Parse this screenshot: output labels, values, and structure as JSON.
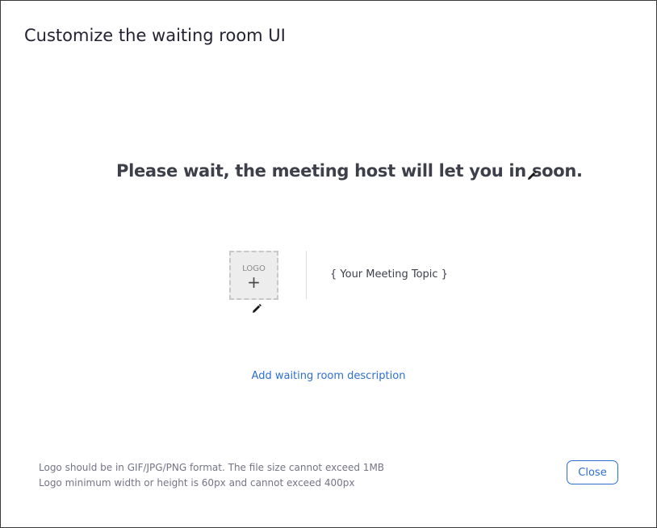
{
  "dialog": {
    "title": "Customize the waiting room UI"
  },
  "waiting_room": {
    "heading": "Please wait, the meeting host will let you in soon.",
    "logo_label": "LOGO",
    "logo_plus": "+",
    "meeting_topic": "{ Your Meeting Topic }",
    "add_description_link": "Add waiting room description"
  },
  "hints": {
    "line1": "Logo should be in GIF/JPG/PNG format. The file size cannot exceed 1MB",
    "line2": "Logo minimum width or height is 60px and cannot exceed 400px"
  },
  "footer": {
    "close_label": "Close"
  },
  "icons": {
    "edit": "pencil-icon"
  },
  "colors": {
    "accent": "#2d6fd1",
    "heading": "#3d3f4a",
    "hint": "#747487"
  }
}
